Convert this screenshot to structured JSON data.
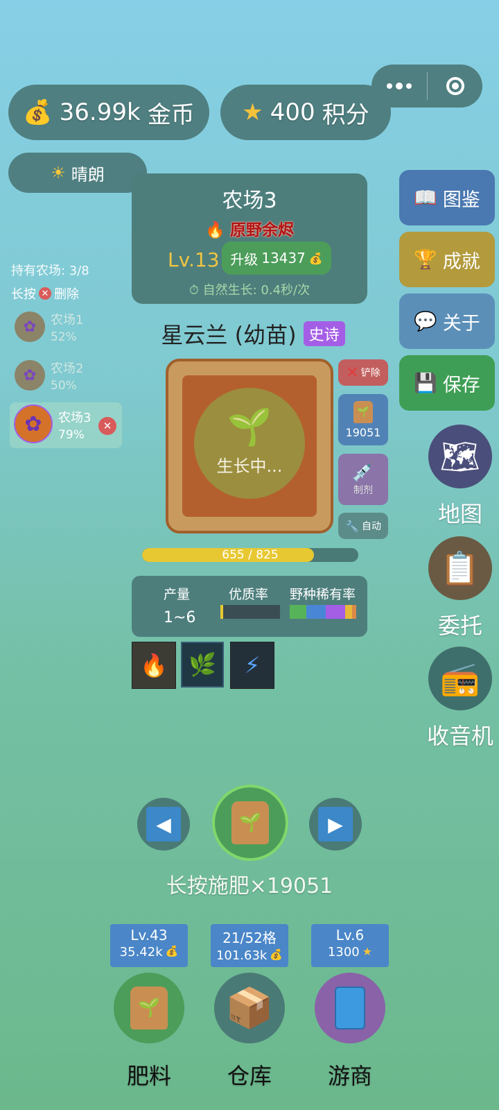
{
  "gold": {
    "value": "36.99k",
    "unit": "金币"
  },
  "points": {
    "value": "400",
    "unit": "积分"
  },
  "weather": "晴朗",
  "farm_panel": {
    "name": "农场3",
    "title": "原野余烬",
    "level": "Lv.13",
    "upgrade_label": "升级",
    "upgrade_cost": "13437",
    "growth": "自然生长: 0.4秒/次"
  },
  "farms": {
    "owned": "持有农场: 3/8",
    "hint_prefix": "长按",
    "hint_suffix": "删除",
    "items": [
      {
        "name": "农场1",
        "pct": "52%"
      },
      {
        "name": "农场2",
        "pct": "50%"
      },
      {
        "name": "农场3",
        "pct": "79%"
      }
    ]
  },
  "plant": {
    "name": "星云兰 (幼苗)",
    "rarity": "史诗",
    "status": "生长中...",
    "progress_text": "655 / 825",
    "progress_fraction": 0.794
  },
  "actions": {
    "remove": "铲除",
    "fert_count": "19051",
    "potion": "制剂",
    "auto": "自动"
  },
  "stats": {
    "yield_label": "产量",
    "yield_value": "1~6",
    "quality_label": "优质率",
    "wild_label": "野种稀有率"
  },
  "side_menu": {
    "collection": "图鉴",
    "achievements": "成就",
    "about": "关于",
    "save": "保存",
    "map": "地图",
    "commission": "委托",
    "radio": "收音机"
  },
  "fertilize_hint": "长按施肥×19051",
  "bottom": {
    "fertilizer": {
      "badge_top": "Lv.43",
      "badge_bottom": "35.42k",
      "label": "肥料"
    },
    "warehouse": {
      "badge_top": "21/52格",
      "badge_bottom": "101.63k",
      "label": "仓库"
    },
    "merchant": {
      "badge_top": "Lv.6",
      "badge_bottom": "1300",
      "label": "游商"
    }
  },
  "colors": {
    "panel": "#4d7e7c",
    "gold": "#f0c541",
    "epic": "#a45ee6",
    "blue_btn": "#4a78b0",
    "green_btn": "#3f9e55"
  }
}
